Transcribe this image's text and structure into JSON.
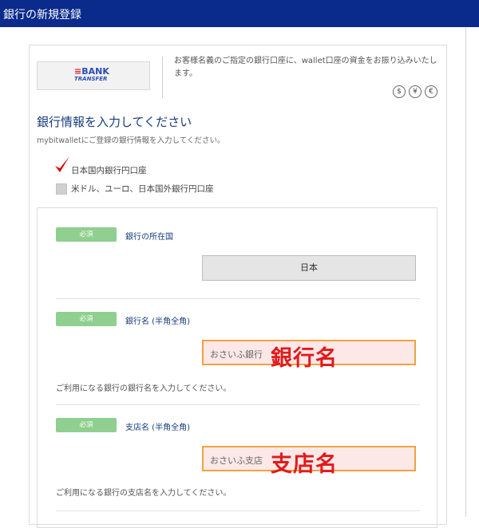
{
  "header": {
    "title": "銀行の新規登録"
  },
  "method": {
    "logo": {
      "line1": "BANK",
      "line2": "TRANSFER"
    },
    "description": "お客様名義のご指定の銀行口座に、wallet口座の資金をお振り込みいたします。",
    "currencies": [
      "$",
      "¥",
      "€"
    ]
  },
  "form": {
    "title": "銀行情報を入力してください",
    "subtitle": "mybitwalletにご登録の銀行情報を入力してください。",
    "account_types": [
      {
        "label": "日本国内銀行円口座",
        "checked": true
      },
      {
        "label": "米ドル、ユーロ、日本国外銀行円口座",
        "checked": false
      }
    ],
    "fields": [
      {
        "badge": "必須",
        "label": "銀行の所在国",
        "value": "日本"
      },
      {
        "badge": "必須",
        "label": "銀行名 (半角全角)",
        "value": "おさいふ銀行",
        "overlay": "銀行名",
        "hint": "ご利用になる銀行の銀行名を入力してください。"
      },
      {
        "badge": "必須",
        "label": "支店名 (半角全角)",
        "value": "おさいふ支店",
        "overlay": "支店名",
        "hint": "ご利用になる銀行の支店名を入力してください。"
      }
    ]
  },
  "colors": {
    "header_bg": "#0a2a8c",
    "badge": "#8fcf8f",
    "title": "#1a3d7c",
    "highlight_border": "#f0a340",
    "overlay_text": "#e21a1a",
    "check": "#e00000"
  }
}
